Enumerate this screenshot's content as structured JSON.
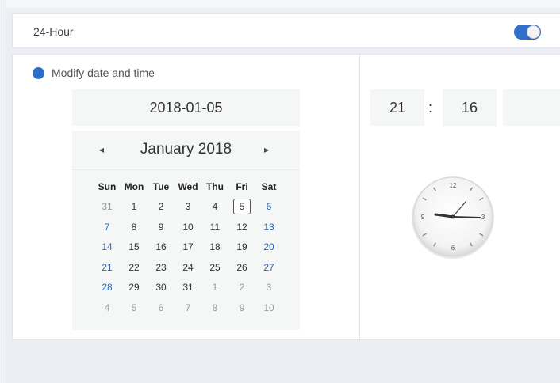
{
  "hour24": {
    "label": "24-Hour",
    "enabled": true
  },
  "modify": {
    "label": "Modify date and time"
  },
  "date": {
    "value": "2018-01-05"
  },
  "calendar": {
    "prev_icon": "◂",
    "next_icon": "▸",
    "title": "January 2018",
    "weekdays": [
      "Sun",
      "Mon",
      "Tue",
      "Wed",
      "Thu",
      "Fri",
      "Sat"
    ],
    "weeks": [
      [
        "31",
        "1",
        "2",
        "3",
        "4",
        "5",
        "6"
      ],
      [
        "7",
        "8",
        "9",
        "10",
        "11",
        "12",
        "13"
      ],
      [
        "14",
        "15",
        "16",
        "17",
        "18",
        "19",
        "20"
      ],
      [
        "21",
        "22",
        "23",
        "24",
        "25",
        "26",
        "27"
      ],
      [
        "28",
        "29",
        "30",
        "31",
        "1",
        "2",
        "3"
      ],
      [
        "4",
        "5",
        "6",
        "7",
        "8",
        "9",
        "10"
      ]
    ],
    "selected": "5"
  },
  "time": {
    "hour": "21",
    "separator": ":",
    "minute": "16",
    "second": ""
  },
  "clock": {
    "labels": {
      "top": "12",
      "right": "3",
      "bottom": "6",
      "left": "9"
    }
  },
  "colors": {
    "accent": "#2f6fc8",
    "weekend": "#2a66b8",
    "muted": "#999999"
  },
  "icons": {
    "radio": "radio-dot-icon",
    "toggle": "toggle-switch",
    "prev": "triangle-left-icon",
    "next": "triangle-right-icon",
    "clock": "analog-clock-icon"
  }
}
